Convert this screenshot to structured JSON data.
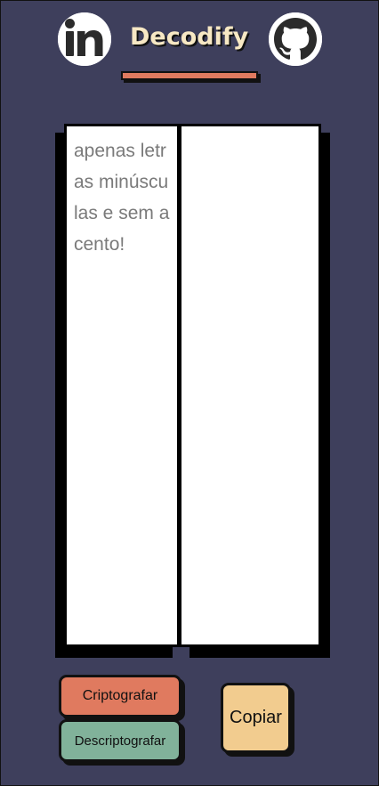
{
  "header": {
    "brand": "Decodify",
    "linkedin_icon": "linkedin-icon",
    "github_icon": "github-icon"
  },
  "input": {
    "placeholder": "apenas letras minúsculas e sem acento!"
  },
  "buttons": {
    "encrypt_label": "Criptografar",
    "decrypt_label": "Descriptografar",
    "copy_label": "Copiar"
  },
  "colors": {
    "background": "#3e3f5c",
    "accent_red": "#e07a5f",
    "accent_green": "#81b29a",
    "accent_yellow": "#f2cc8f",
    "brand_text": "#f7e8c4"
  }
}
